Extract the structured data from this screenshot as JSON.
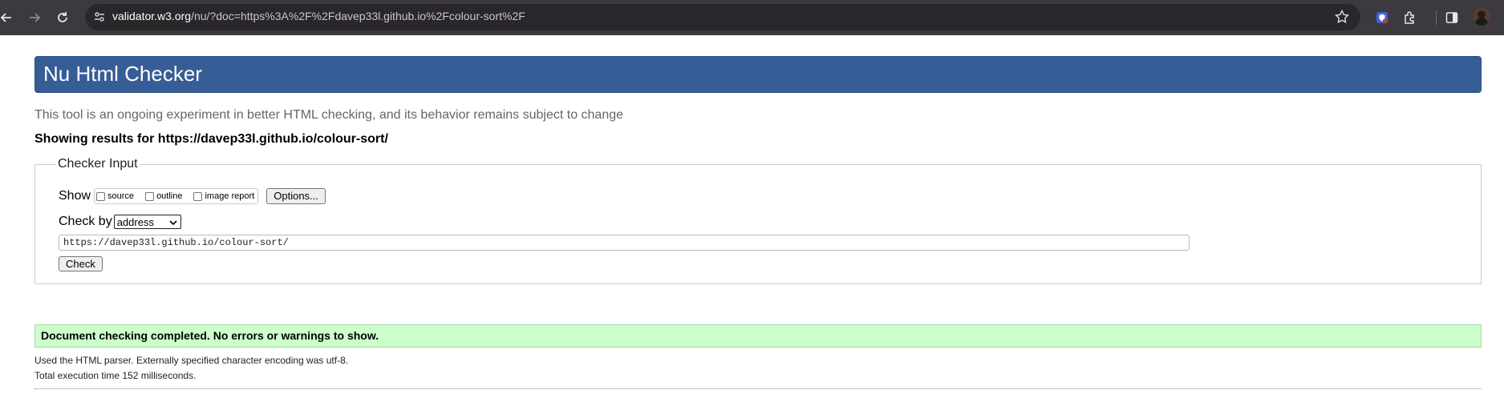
{
  "browser": {
    "url_host": "validator.w3.org",
    "url_rest": "/nu/?doc=https%3A%2F%2Fdavep33l.github.io%2Fcolour-sort%2F",
    "icons": [
      "back-icon",
      "forward-icon",
      "reload-icon",
      "site-info-icon",
      "bookmark-star-icon",
      "extension-shield-icon",
      "extensions-puzzle-icon",
      "side-panel-icon",
      "profile-avatar"
    ]
  },
  "header": {
    "title": "Nu Html Checker"
  },
  "subtitle": "This tool is an ongoing experiment in better HTML checking, and its behavior remains subject to change",
  "showing_results": "Showing results for https://davep33l.github.io/colour-sort/",
  "checker_input": {
    "legend": "Checker Input",
    "show_label": "Show",
    "options": [
      {
        "label": "source",
        "checked": false
      },
      {
        "label": "outline",
        "checked": false
      },
      {
        "label": "image report",
        "checked": false
      }
    ],
    "options_button": "Options...",
    "check_by_label": "Check by",
    "check_by_value": "address",
    "url_value": "https://davep33l.github.io/colour-sort/",
    "check_button": "Check"
  },
  "result": {
    "success_message": "Document checking completed. No errors or warnings to show.",
    "parser_info": "Used the HTML parser. Externally specified character encoding was utf-8.",
    "execution_time": "Total execution time 152 milliseconds."
  },
  "colors": {
    "header_bg": "#365d95",
    "success_bg": "#ccffcc",
    "browser_bar": "#3c3a3f"
  }
}
